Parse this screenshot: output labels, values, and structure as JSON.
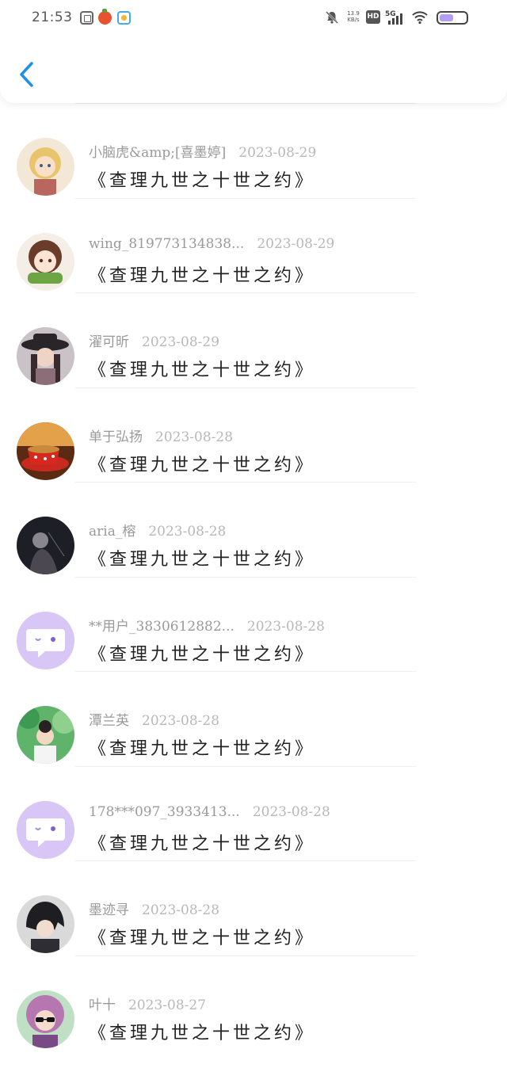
{
  "status_bar": {
    "time": "21:53",
    "speed_top": "13.9",
    "speed_bottom": "KB/s",
    "hd": "HD",
    "network": "5G"
  },
  "icons": {
    "back": "chevron-left-icon",
    "default_avatar": "chat-bubble-icon"
  },
  "colors": {
    "accent": "#1e90e8",
    "battery": "#b39ef3",
    "default_avatar": "#d8c6f7"
  },
  "items": [
    {
      "user": "小脑虎&amp;[喜墨婷]",
      "date": "2023-08-29",
      "content": "《查理九世之十世之约》",
      "avatar": "anime-girl-blonde"
    },
    {
      "user": "wing_819773134838...",
      "date": "2023-08-29",
      "content": "《查理九世之十世之约》",
      "avatar": "anime-boy-brown-hair"
    },
    {
      "user": "濯可昕",
      "date": "2023-08-29",
      "content": "《查理九世之十世之约》",
      "avatar": "girl-black-hat"
    },
    {
      "user": "单于弘扬",
      "date": "2023-08-28",
      "content": "《查理九世之十世之约》",
      "avatar": "red-teacup"
    },
    {
      "user": "aria_榕",
      "date": "2023-08-28",
      "content": "《查理九世之十世之约》",
      "avatar": "dark-figure"
    },
    {
      "user": "**用户_3830612882...",
      "date": "2023-08-28",
      "content": "《查理九世之十世之约》",
      "avatar": "default"
    },
    {
      "user": "潭兰英",
      "date": "2023-08-28",
      "content": "《查理九世之十世之约》",
      "avatar": "child-green-leaves"
    },
    {
      "user": "178***097_3933413...",
      "date": "2023-08-28",
      "content": "《查理九世之十世之约》",
      "avatar": "default"
    },
    {
      "user": "墨迹寻",
      "date": "2023-08-28",
      "content": "《查理九世之十世之约》",
      "avatar": "anime-boy-dark"
    },
    {
      "user": "叶十",
      "date": "2023-08-27",
      "content": "《查理九世之十世之约》",
      "avatar": "anime-girl-pink-sunglasses"
    }
  ]
}
